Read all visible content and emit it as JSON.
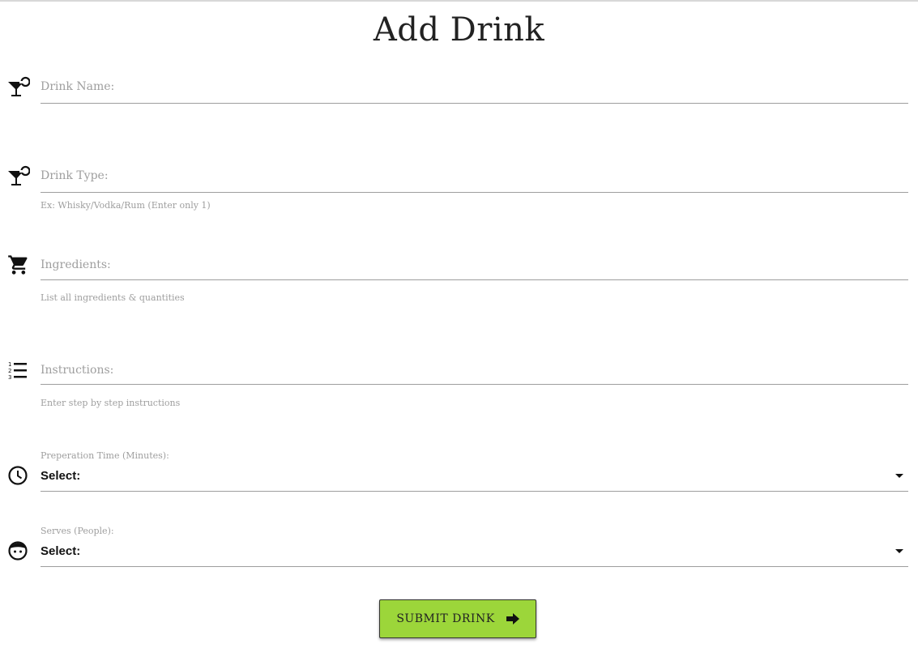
{
  "page": {
    "title": "Add Drink"
  },
  "fields": {
    "drink_name": {
      "label": "Drink Name:",
      "value": "",
      "icon": "cocktail-icon"
    },
    "drink_type": {
      "label": "Drink Type:",
      "value": "",
      "helper": "Ex: Whisky/Vodka/Rum (Enter only 1)",
      "icon": "cocktail-icon"
    },
    "ingredients": {
      "label": "Ingredients:",
      "value": "",
      "helper": "List all ingredients & quantities",
      "icon": "shopping-cart-icon"
    },
    "instructions": {
      "label": "Instructions:",
      "value": "",
      "helper": "Enter step by step instructions",
      "icon": "numbered-list-icon"
    },
    "prep_time": {
      "label": "Preperation Time (Minutes):",
      "selected": "Select:",
      "icon": "clock-icon"
    },
    "serves": {
      "label": "Serves (People):",
      "selected": "Select:",
      "icon": "face-icon"
    }
  },
  "submit": {
    "label": "SUBMIT DRINK",
    "icon": "arrow-right-icon"
  },
  "colors": {
    "accent": "#9cd63a",
    "line": "#9e9e9e",
    "muted_text": "#9e9e9e"
  }
}
